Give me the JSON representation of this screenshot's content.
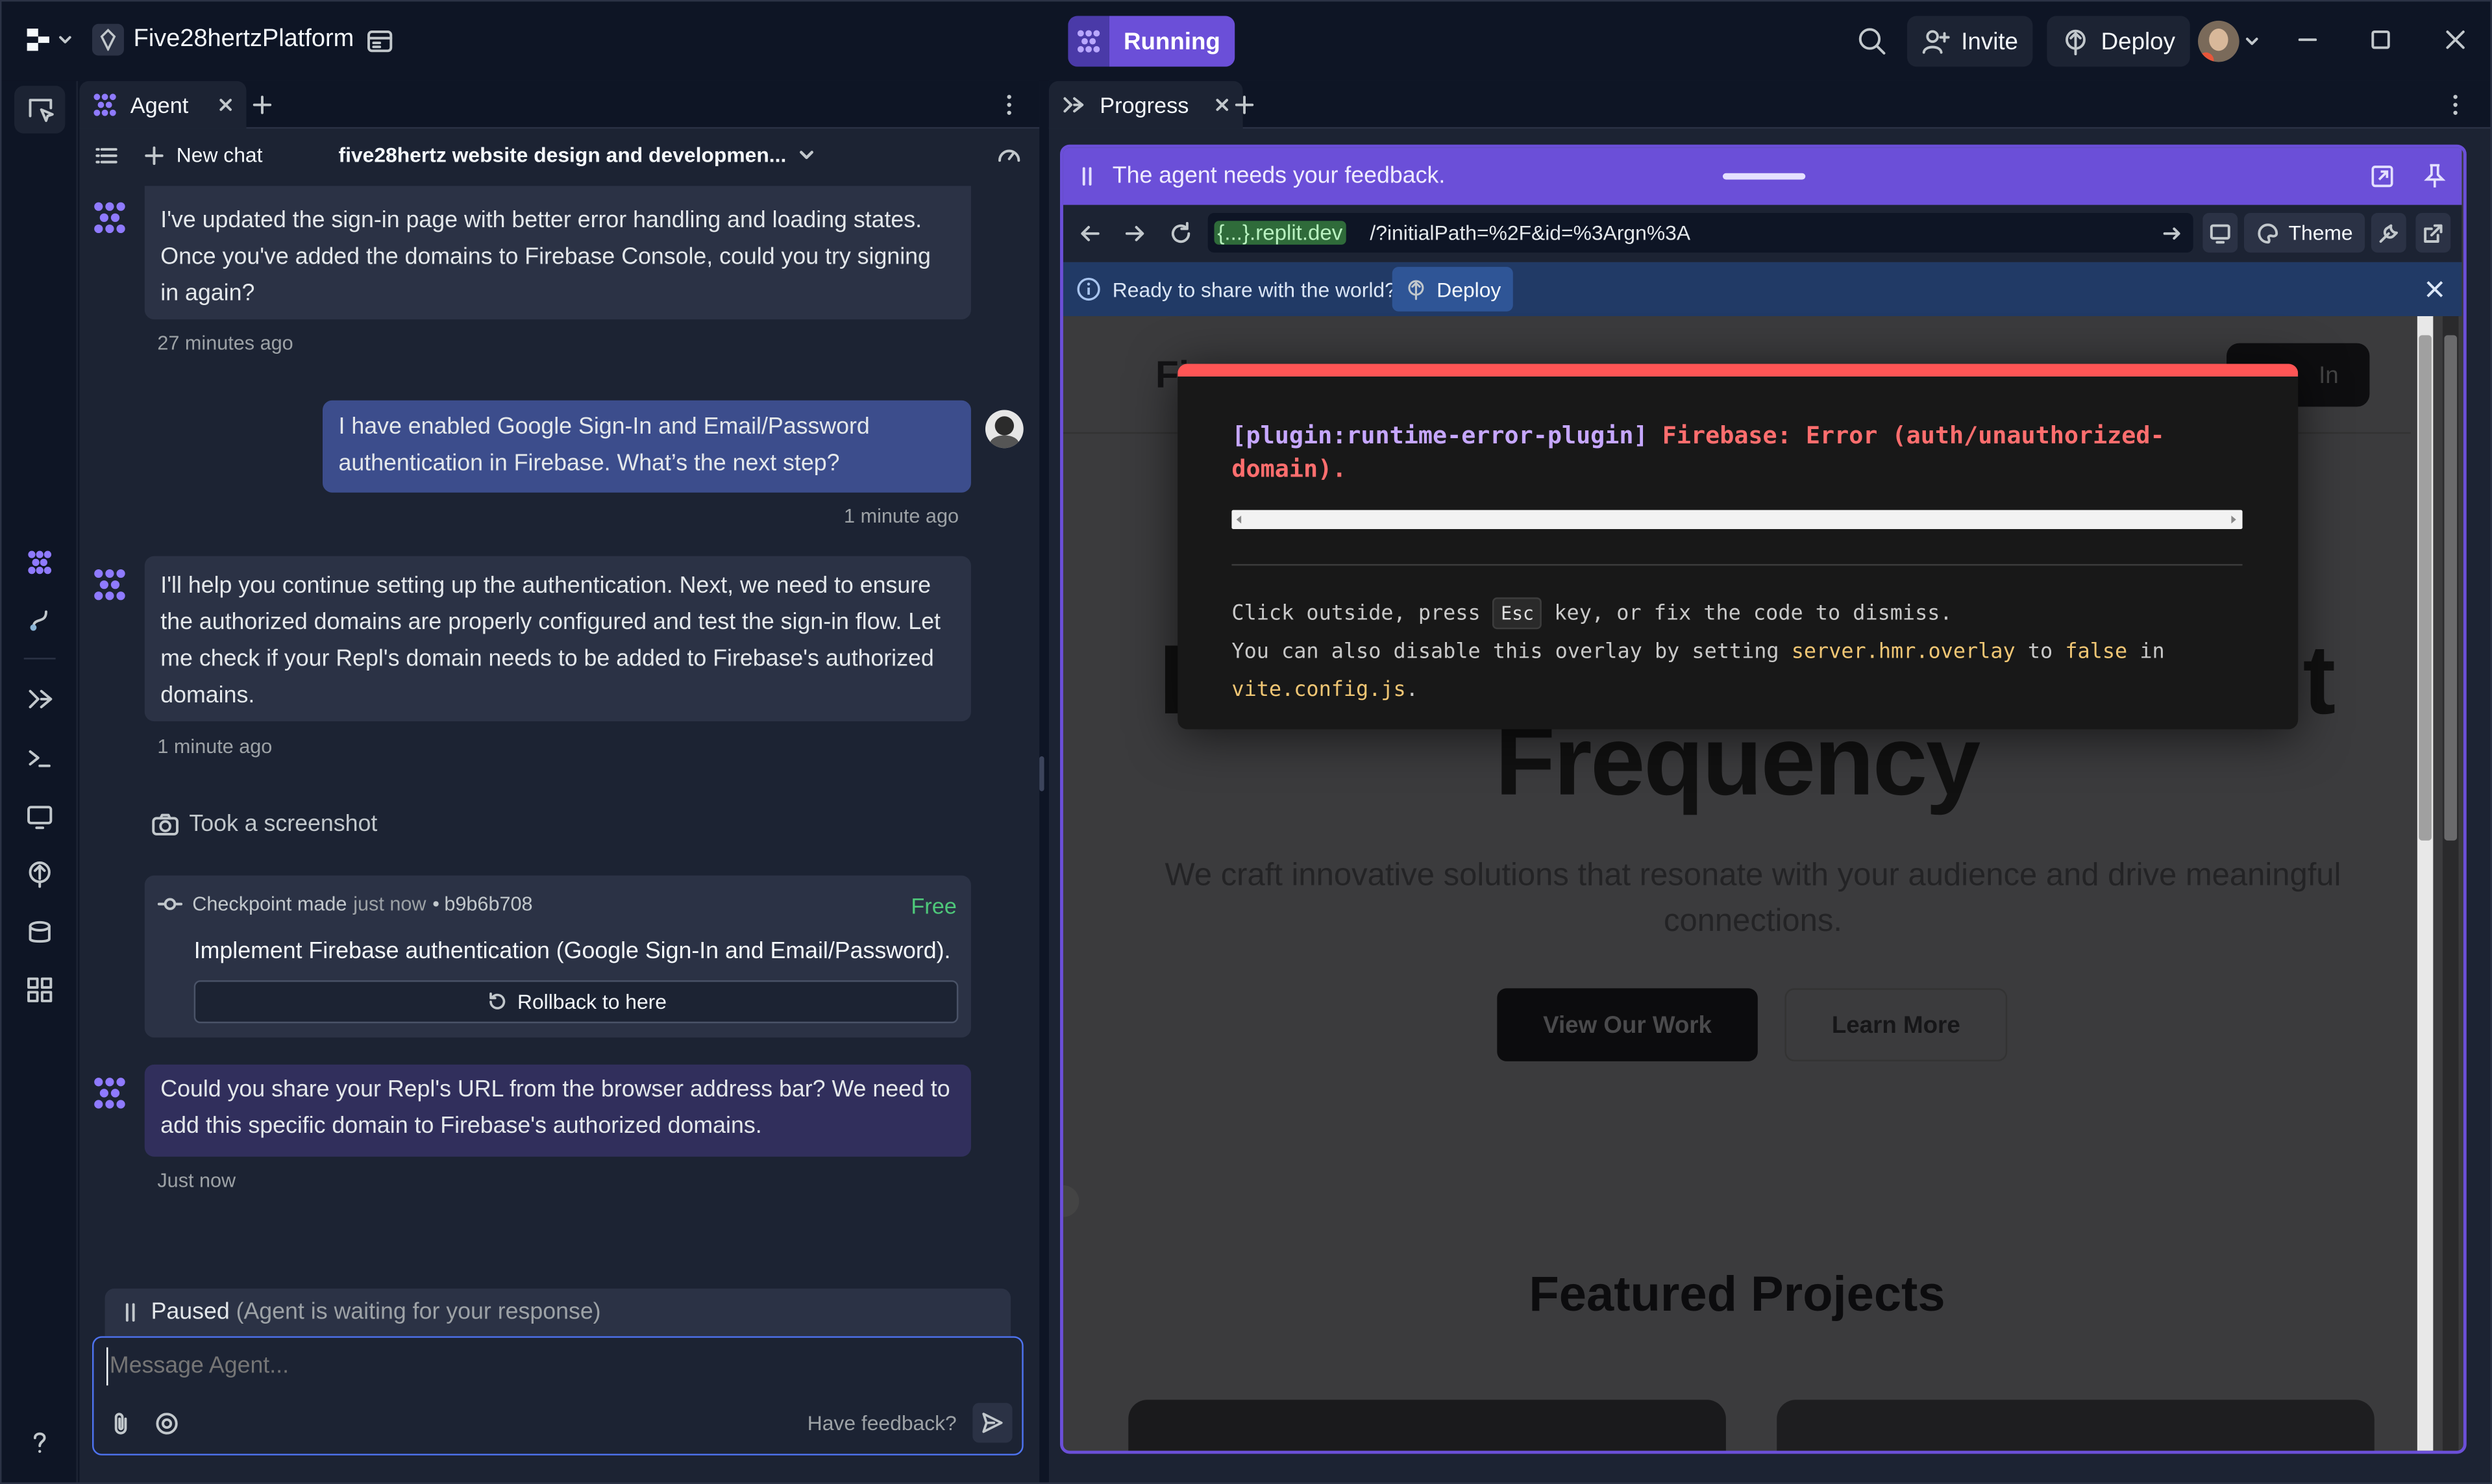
{
  "topbar": {
    "project_name": "Five28hertzPlatform",
    "run_label": "Running",
    "invite_label": "Invite",
    "deploy_label": "Deploy"
  },
  "left_pane": {
    "tab_label": "Agent",
    "new_chat_label": "New chat",
    "chat_title": "five28hertz website design and developmen...",
    "messages": [
      {
        "text": "I've updated the sign-in page with better error handling and loading states. Once you've added the domains to Firebase Console, could you try signing in again?",
        "time": "27 minutes ago"
      },
      {
        "text": "I have enabled Google Sign-In and Email/Password authentication in Firebase. What’s the next step?",
        "time": "1 minute ago"
      },
      {
        "text": "I'll help you continue setting up the authentication. Next, we need to ensure the authorized domains are properly configured and test the sign-in flow. Let me check if your Repl's domain needs to be added to Firebase's authorized domains.",
        "time": "1 minute ago"
      },
      {
        "text": "Could you share your Repl's URL from the browser address bar? We need to add this specific domain to Firebase's authorized domains.",
        "time": "Just now"
      }
    ],
    "screenshot_label": "Took a screenshot",
    "checkpoint": {
      "label": "Checkpoint made",
      "when": "just now",
      "separator": "•",
      "hash": "b9b6b708",
      "price": "Free",
      "description": "Implement Firebase authentication (Google Sign-In and Email/Password).",
      "rollback_label": "Rollback to here"
    },
    "paused_label": "Paused",
    "paused_detail": "(Agent is waiting for your response)",
    "input_placeholder": "Message Agent...",
    "feedback_label": "Have feedback?"
  },
  "right_pane": {
    "tab_label": "Progress",
    "feedback_banner": "The agent needs your feedback.",
    "url_domain": "{...}.replit.dev",
    "url_path": "/?initialPath=%2F&id=%3Argn%3A",
    "theme_label": "Theme",
    "share_text": "Ready to share with the world?",
    "share_deploy_label": "Deploy"
  },
  "site": {
    "logo_partial": "Fi",
    "signin_partial": "In",
    "hero_left_partial": "I",
    "hero_right_partial": "t",
    "hero_title": "Frequency",
    "hero_subtitle": "We craft innovative solutions that resonate with your audience and drive meaningful connections.",
    "primary_cta": "View Our Work",
    "secondary_cta": "Learn More",
    "featured_heading": "Featured Projects"
  },
  "error_overlay": {
    "plugin": "[plugin:runtime-error-plugin]",
    "message": "Firebase: Error (auth/unauthorized-domain).",
    "hint_before": "Click outside, press",
    "key": "Esc",
    "hint_after": "key, or fix the code to dismiss.",
    "hint2_before": "You can also disable this overlay by setting",
    "setting": "server.hmr.overlay",
    "hint2_mid": "to",
    "value": "false",
    "hint2_after": "in",
    "file": "vite.config.js",
    "period": "."
  },
  "colors": {
    "app_bg": "#0e1525",
    "surface": "#1c2333",
    "user_bubble": "#3c4d8c",
    "agent_accent": "#7b61ff",
    "running_bg": "#6b4fd8",
    "error_red": "#ff5555",
    "success_green": "#4ec87a",
    "overlay_yellow": "#f0c674"
  }
}
